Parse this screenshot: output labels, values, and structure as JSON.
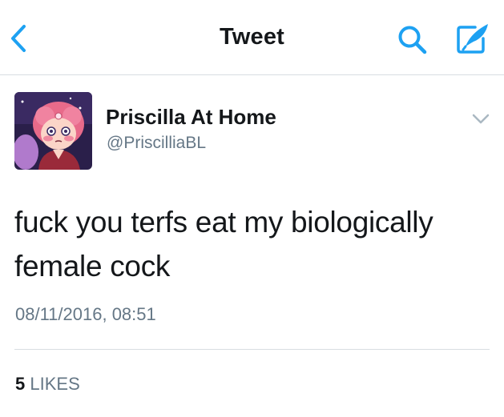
{
  "colors": {
    "accent": "#1da1f2",
    "text_primary": "#14171a",
    "text_secondary": "#657786",
    "divider": "#d8dde1"
  },
  "nav": {
    "title": "Tweet",
    "back_icon": "chevron-left-icon",
    "search_icon": "search-icon",
    "compose_icon": "compose-icon"
  },
  "tweet": {
    "author": {
      "display_name": "Priscilla At Home",
      "handle": "@PriscilliaBL",
      "avatar_icon": "avatar-illustration"
    },
    "more_icon": "chevron-down-icon",
    "text": "fuck you terfs eat my biologically female cock",
    "timestamp": "08/11/2016, 08:51",
    "stats": {
      "likes_count": "5",
      "likes_label": "LIKES"
    }
  }
}
